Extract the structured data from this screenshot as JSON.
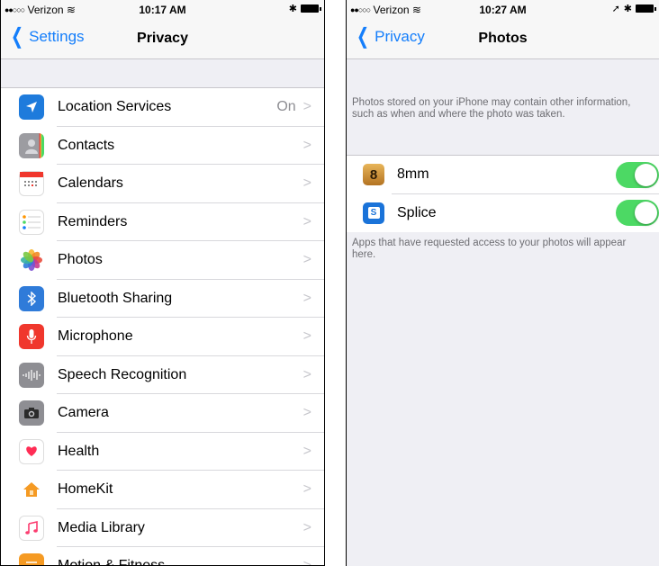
{
  "left": {
    "status": {
      "carrier": "Verizon",
      "time": "10:17 AM"
    },
    "nav": {
      "back": "Settings",
      "title": "Privacy"
    },
    "items": [
      {
        "label": "Location Services",
        "detail": "On",
        "icon": "location-arrow-icon",
        "color": "#1e7bdc"
      },
      {
        "label": "Contacts",
        "detail": "",
        "icon": "contacts-icon",
        "color": "#8e8e93"
      },
      {
        "label": "Calendars",
        "detail": "",
        "icon": "calendar-icon",
        "color": "#ffffff"
      },
      {
        "label": "Reminders",
        "detail": "",
        "icon": "reminders-icon",
        "color": "#ffffff"
      },
      {
        "label": "Photos",
        "detail": "",
        "icon": "photos-icon",
        "color": "#ffffff"
      },
      {
        "label": "Bluetooth Sharing",
        "detail": "",
        "icon": "bluetooth-icon",
        "color": "#2f7bd9"
      },
      {
        "label": "Microphone",
        "detail": "",
        "icon": "microphone-icon",
        "color": "#f0372d"
      },
      {
        "label": "Speech Recognition",
        "detail": "",
        "icon": "speech-recognition-icon",
        "color": "#8e8e93"
      },
      {
        "label": "Camera",
        "detail": "",
        "icon": "camera-icon",
        "color": "#8e8e93"
      },
      {
        "label": "Health",
        "detail": "",
        "icon": "health-icon",
        "color": "#ffffff"
      },
      {
        "label": "HomeKit",
        "detail": "",
        "icon": "homekit-icon",
        "color": "#ffffff"
      },
      {
        "label": "Media Library",
        "detail": "",
        "icon": "music-icon",
        "color": "#ffffff"
      },
      {
        "label": "Motion & Fitness",
        "detail": "",
        "icon": "motion-icon",
        "color": "#f59a23"
      }
    ]
  },
  "right": {
    "status": {
      "carrier": "Verizon",
      "time": "10:27 AM"
    },
    "nav": {
      "back": "Privacy",
      "title": "Photos"
    },
    "header_note": "Photos stored on your iPhone may contain other information, such as when and where the photo was taken.",
    "apps": [
      {
        "label": "8mm",
        "icon_text": "8",
        "icon": "8mm-app-icon",
        "enabled": true
      },
      {
        "label": "Splice",
        "icon_text": "S",
        "icon": "splice-app-icon",
        "enabled": true
      }
    ],
    "footer_note": "Apps that have requested access to your photos will appear here."
  },
  "colors": {
    "accent": "#147efb",
    "toggle_on": "#4cd964"
  }
}
